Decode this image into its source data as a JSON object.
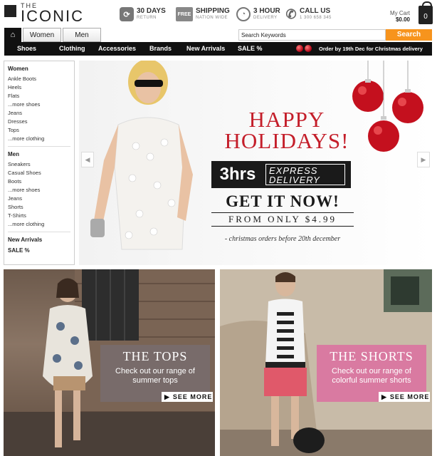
{
  "header": {
    "logo_the": "THE",
    "logo_main": "ICONIC",
    "features": [
      {
        "title": "30 DAYS",
        "sub": "RETURN",
        "icon": "refresh-icon"
      },
      {
        "title": "SHIPPING",
        "sub": "NATION WIDE",
        "icon": "free-shipping-icon",
        "badge": "FREE"
      },
      {
        "title": "3 HOUR",
        "sub": "DELIVERY",
        "icon": "clock-icon"
      },
      {
        "title": "CALL US",
        "sub": "1 300 658 345",
        "icon": "phone-icon"
      }
    ],
    "cart_label": "My Cart",
    "cart_total": "$0.00",
    "cart_count": "0"
  },
  "nav": {
    "tabs": [
      "Women",
      "Men"
    ],
    "search_placeholder": "Search Keywords",
    "search_button": "Search"
  },
  "catbar": {
    "items": [
      "Shoes",
      "Clothing",
      "Accessories",
      "Brands",
      "New Arrivals",
      "SALE %"
    ],
    "promo": "Order by 19th Dec for Christmas delivery"
  },
  "sidebar": {
    "women_head": "Women",
    "women": [
      "Ankle Boots",
      "Heels",
      "Flats",
      "...more shoes",
      "Jeans",
      "Dresses",
      "Tops",
      "...more clothing"
    ],
    "men_head": "Men",
    "men": [
      "Sneakers",
      "Casual Shoes",
      "Boots",
      "...more shoes",
      "Jeans",
      "Shorts",
      "T-Shirts",
      "...more clothing"
    ],
    "new_arrivals": "New Arrivals",
    "sale": "SALE %"
  },
  "hero": {
    "line1": "HAPPY",
    "line2": "HOLIDAYS!",
    "hrs": "3hrs",
    "express": "EXPRESS",
    "delivery": "DELIVERY",
    "get": "GET IT NOW!",
    "from": "FROM ONLY $4.99",
    "note": "- christmas orders before 20th december",
    "accent": "#c41e2a"
  },
  "tiles": {
    "left": {
      "title": "THE TOPS",
      "text1": "Check out our range of",
      "text2": "summer tops",
      "cta": "SEE MORE"
    },
    "right": {
      "title": "THE SHORTS",
      "text1": "Check out our range of",
      "text2": "colorful summer shorts",
      "cta": "SEE MORE"
    }
  }
}
